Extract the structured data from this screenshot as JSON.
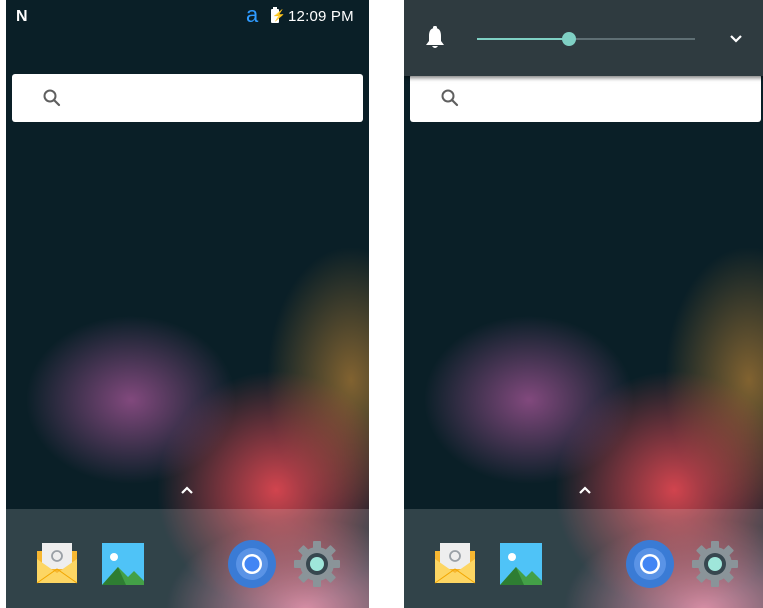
{
  "status_bar": {
    "n_logo": "N",
    "a_logo": "a",
    "battery_glyph": "⚡",
    "time": "12:09 PM"
  },
  "volume_panel": {
    "level": 0.42,
    "accent_color": "#7fd0c4"
  },
  "search": {
    "icon": "search-icon"
  },
  "dock": {
    "apps": [
      "email-icon",
      "gallery-icon",
      "chrome-icon",
      "settings-icon"
    ]
  },
  "colors": {
    "wallpaper_base": "#0a1f27",
    "panel_bg": "#2f3b40",
    "brand_a": "#2f9bff"
  }
}
